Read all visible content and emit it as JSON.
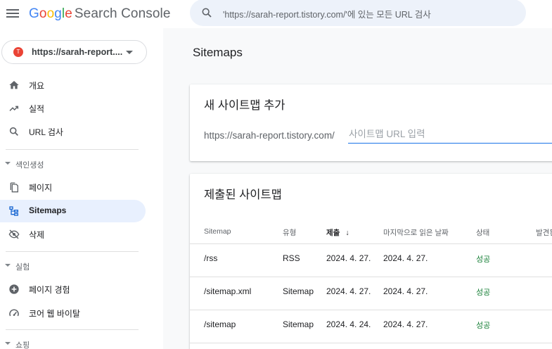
{
  "header": {
    "logo_letters": [
      "G",
      "o",
      "o",
      "g",
      "l",
      "e"
    ],
    "product_name": "Search Console",
    "search_placeholder": "'https://sarah-report.tistory.com/'에 있는 모든 URL 검사"
  },
  "property": {
    "favicon_letter": "T",
    "label": "https://sarah-report...."
  },
  "sidebar": {
    "items": [
      {
        "label": "개요",
        "icon": "home-icon"
      },
      {
        "label": "실적",
        "icon": "trending-up-icon"
      },
      {
        "label": "URL 검사",
        "icon": "search-icon"
      }
    ],
    "sections": [
      {
        "label": "색인생성",
        "items": [
          {
            "label": "페이지",
            "icon": "pages-icon"
          },
          {
            "label": "Sitemaps",
            "icon": "sitemap-icon",
            "active": true
          },
          {
            "label": "삭제",
            "icon": "visibility-off-icon"
          }
        ]
      },
      {
        "label": "실험",
        "items": [
          {
            "label": "페이지 경험",
            "icon": "add-circle-icon"
          },
          {
            "label": "코어 웹 바이탈",
            "icon": "speed-icon"
          }
        ]
      },
      {
        "label": "쇼핑",
        "items": []
      }
    ]
  },
  "main": {
    "title": "Sitemaps",
    "add_card": {
      "title": "새 사이트맵 추가",
      "prefix": "https://sarah-report.tistory.com/",
      "input_placeholder": "사이트맵 URL 입력",
      "input_value": ""
    },
    "list_card": {
      "title": "제출된 사이트맵",
      "columns": [
        "Sitemap",
        "유형",
        "제출",
        "마지막으로 읽은 날짜",
        "상태",
        "발견된"
      ],
      "sort_arrow": "↓",
      "rows": [
        {
          "sitemap": "/rss",
          "type": "RSS",
          "submitted": "2024. 4. 27.",
          "last_read": "2024. 4. 27.",
          "status": "성공"
        },
        {
          "sitemap": "/sitemap.xml",
          "type": "Sitemap",
          "submitted": "2024. 4. 27.",
          "last_read": "2024. 4. 27.",
          "status": "성공"
        },
        {
          "sitemap": "/sitemap",
          "type": "Sitemap",
          "submitted": "2024. 4. 24.",
          "last_read": "2024. 4. 27.",
          "status": "성공"
        }
      ]
    }
  },
  "colors": {
    "accent": "#1a73e8",
    "active_bg": "#e8f0fe",
    "success": "#188038",
    "main_bg": "#f8f9fa"
  }
}
